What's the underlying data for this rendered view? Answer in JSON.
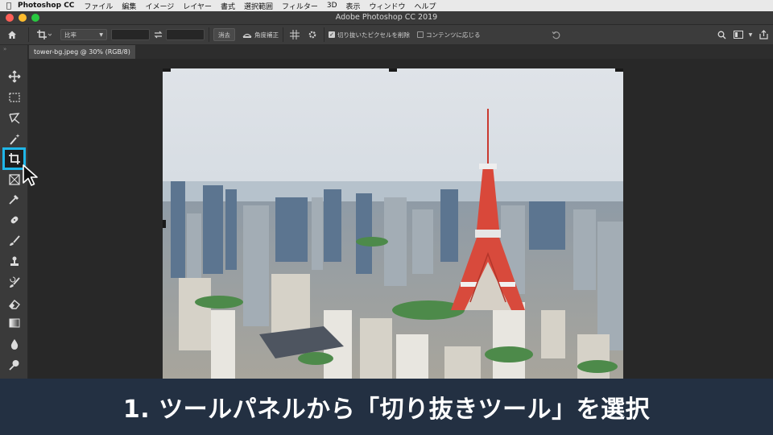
{
  "menubar": {
    "app_name": "Photoshop CC",
    "items": [
      "ファイル",
      "編集",
      "イメージ",
      "レイヤー",
      "書式",
      "選択範囲",
      "フィルター",
      "3D",
      "表示",
      "ウィンドウ",
      "ヘルプ"
    ]
  },
  "window": {
    "title": "Adobe Photoshop CC 2019",
    "traffic_lights": [
      "#ff5f57",
      "#febc2e",
      "#28c840"
    ]
  },
  "options": {
    "ratio_select": "比率",
    "clear_button": "消去",
    "straighten_label": "角度補正",
    "delete_cropped_checked": true,
    "delete_cropped_label": "切り抜いたピクセルを削除",
    "content_aware_checked": false,
    "content_aware_label": "コンテンツに応じる"
  },
  "document": {
    "tab_label": "tower-bg.jpeg @ 30% (RGB/8)"
  },
  "tools": [
    {
      "name": "move",
      "active": false
    },
    {
      "name": "marquee",
      "active": false
    },
    {
      "name": "lasso",
      "active": false
    },
    {
      "name": "quick-select",
      "active": false
    },
    {
      "name": "crop",
      "active": true
    },
    {
      "name": "frame",
      "active": false
    },
    {
      "name": "eyedropper",
      "active": false
    },
    {
      "name": "healing",
      "active": false
    },
    {
      "name": "brush",
      "active": false
    },
    {
      "name": "stamp",
      "active": false
    },
    {
      "name": "history-brush",
      "active": false
    },
    {
      "name": "eraser",
      "active": false
    },
    {
      "name": "gradient",
      "active": false
    },
    {
      "name": "blur",
      "active": false
    },
    {
      "name": "dodge",
      "active": false
    }
  ],
  "colors": {
    "accent": "#1fb6e8",
    "caption_bg": "#233042"
  },
  "caption": "1. ツールパネルから「切り抜きツール」を選択"
}
